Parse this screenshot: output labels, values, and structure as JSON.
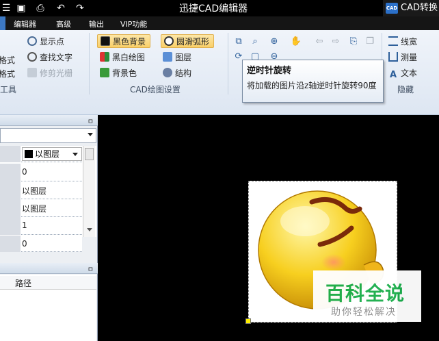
{
  "window": {
    "title": "迅捷CAD编辑器",
    "tab_partial": "CAD转换"
  },
  "menu": {
    "items": [
      "编辑器",
      "高级",
      "输出",
      "VIP功能"
    ]
  },
  "ribbon": {
    "group1": {
      "items": [
        "显示点",
        "查找文字",
        "修剪光栅"
      ],
      "cut_items": [
        "格式",
        "格式"
      ],
      "label": "工具"
    },
    "group2": {
      "items": [
        "黑色背景",
        "圆滑弧形",
        "黑白绘图",
        "图层",
        "背景色",
        "结构"
      ],
      "label": "CAD绘图设置"
    },
    "group4": {
      "items": [
        "线宽",
        "测量",
        "文本"
      ],
      "label": "隐藏"
    }
  },
  "tooltip": {
    "title": "逆时针旋转",
    "description": "将加载的图片沿z轴逆时针旋转90度"
  },
  "properties": {
    "layer_select": "以图层",
    "rows": [
      "0",
      "以图层",
      "以图层",
      "1",
      "0"
    ]
  },
  "files_panel": {
    "column": "路径"
  },
  "watermark": {
    "brand": "百科全说",
    "slogan": "助你轻松解决"
  },
  "colors": {
    "accent": "#3d79c4",
    "highlight": "#f9cf68",
    "watermark_green": "#1cae4c"
  }
}
